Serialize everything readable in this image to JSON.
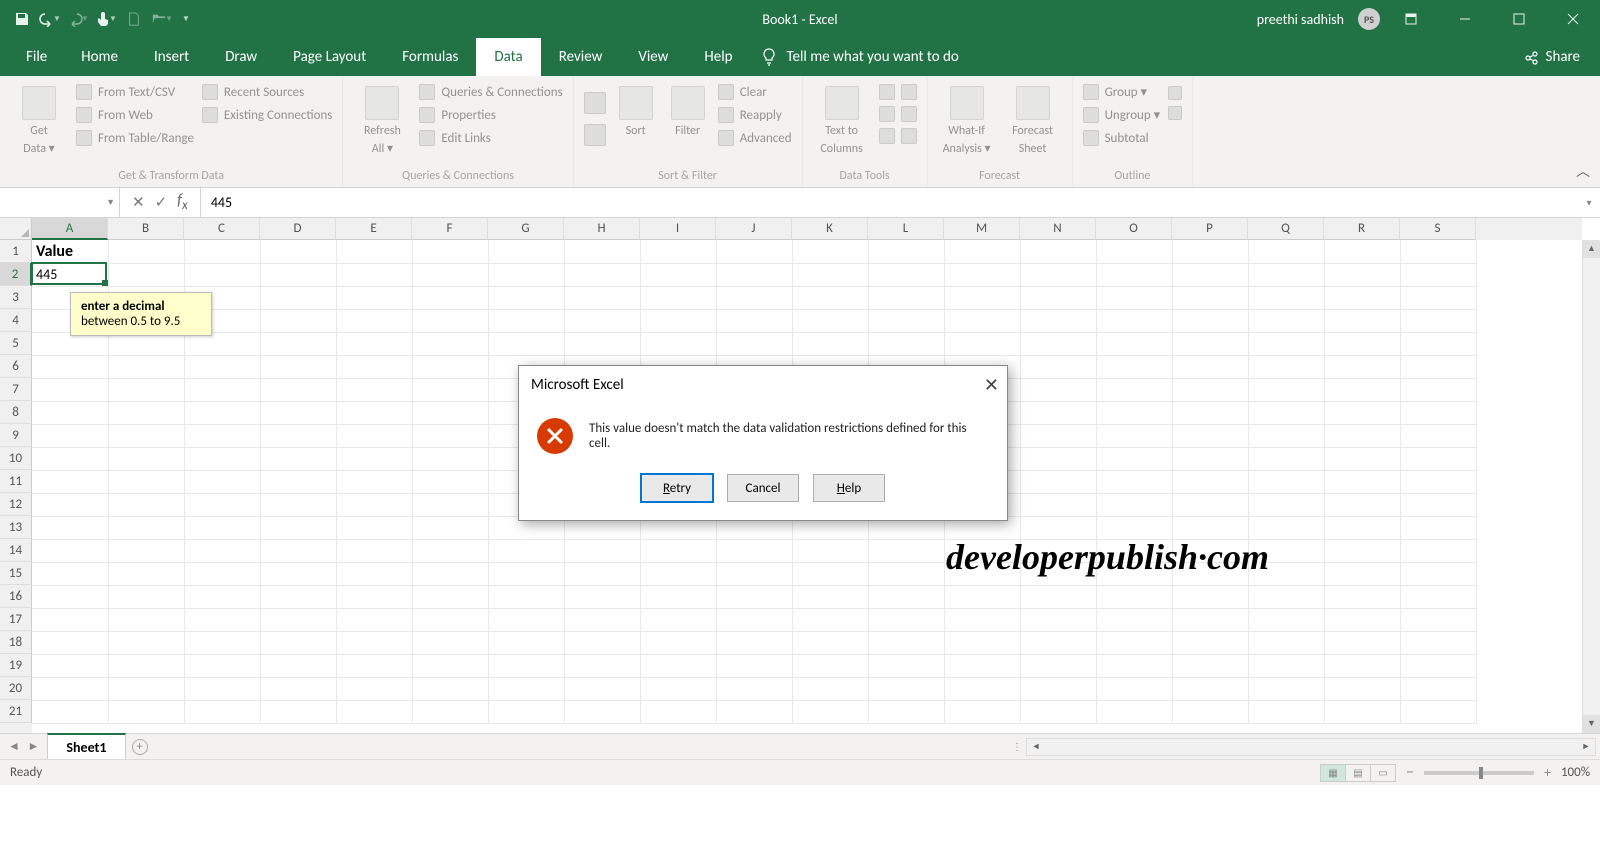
{
  "title": "Book1  -  Excel",
  "user": {
    "name": "preethi sadhish",
    "initials": "PS"
  },
  "qat": [
    "save",
    "undo",
    "redo",
    "touch",
    "new",
    "open"
  ],
  "tabs": [
    "File",
    "Home",
    "Insert",
    "Draw",
    "Page Layout",
    "Formulas",
    "Data",
    "Review",
    "View",
    "Help"
  ],
  "activeTab": "Data",
  "tellme": "Tell me what you want to do",
  "share": "Share",
  "ribbon": {
    "groups": [
      {
        "label": "Get & Transform Data",
        "big": {
          "line1": "Get",
          "line2": "Data ▾"
        },
        "items": [
          "From Text/CSV",
          "From Web",
          "From Table/Range",
          "Recent Sources",
          "Existing Connections"
        ]
      },
      {
        "label": "Queries & Connections",
        "big": {
          "line1": "Refresh",
          "line2": "All ▾"
        },
        "items": [
          "Queries & Connections",
          "Properties",
          "Edit Links"
        ]
      },
      {
        "label": "Sort & Filter",
        "bigs": [
          {
            "line1": "",
            "line2": "Sort"
          },
          {
            "line1": "",
            "line2": "Filter"
          }
        ],
        "items": [
          "Clear",
          "Reapply",
          "Advanced"
        ]
      },
      {
        "label": "Data Tools",
        "big": {
          "line1": "Text to",
          "line2": "Columns"
        }
      },
      {
        "label": "Forecast",
        "bigs": [
          {
            "line1": "What-If",
            "line2": "Analysis ▾"
          },
          {
            "line1": "Forecast",
            "line2": "Sheet"
          }
        ]
      },
      {
        "label": "Outline",
        "items": [
          "Group ▾",
          "Ungroup ▾",
          "Subtotal"
        ]
      }
    ]
  },
  "nameBox": "",
  "formulaValue": "445",
  "columns": [
    "A",
    "B",
    "C",
    "D",
    "E",
    "F",
    "G",
    "H",
    "I",
    "J",
    "K",
    "L",
    "M",
    "N",
    "O",
    "P",
    "Q",
    "R",
    "S"
  ],
  "rows": 21,
  "selectedCol": 0,
  "selectedRow": 1,
  "cellData": {
    "A1": "Value",
    "A2": "445"
  },
  "inputMessage": {
    "title": "enter a decimal",
    "body": "between 0.5 to 9.5"
  },
  "dialog": {
    "title": "Microsoft Excel",
    "message": "This value doesn't match the data validation restrictions defined for this cell.",
    "buttons": {
      "retry": "Retry",
      "cancel": "Cancel",
      "help": "Help"
    }
  },
  "sheet": {
    "active": "Sheet1"
  },
  "status": {
    "left": "Ready",
    "zoom": "100%"
  },
  "watermark": "developerpublish·com"
}
